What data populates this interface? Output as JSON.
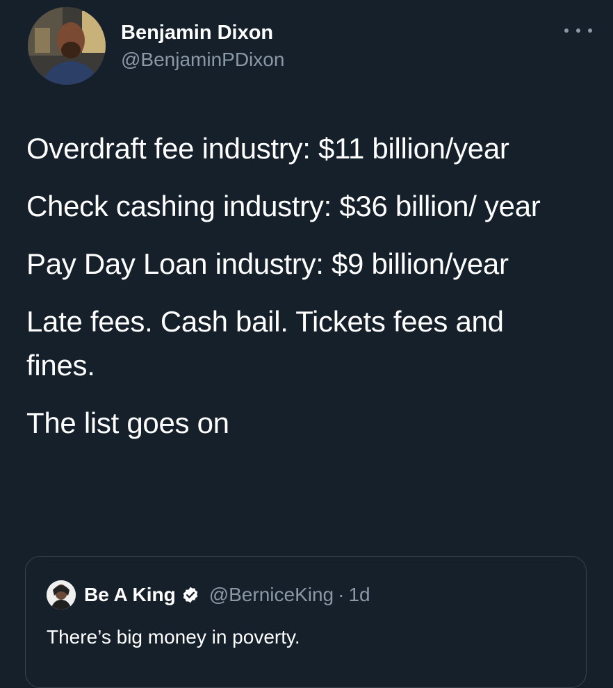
{
  "tweet": {
    "author": {
      "name": "Benjamin Dixon",
      "handle": "@BenjaminPDixon",
      "avatar_icon": "profile-photo"
    },
    "more_icon": "more-horizontal-icon",
    "lines": [
      "Overdraft fee industry: $11 billion/year",
      "Check cashing industry: $36 billion/ year",
      "Pay Day Loan industry: $9 billion/year",
      "Late fees. Cash bail. Tickets fees and fines.",
      "The list goes on"
    ]
  },
  "quoted_tweet": {
    "name": "Be A King",
    "verified_icon": "verified-badge-icon",
    "handle": "@BerniceKing",
    "separator": "·",
    "time": "1d",
    "text": "There’s big money in poverty."
  },
  "colors": {
    "background": "#15202b",
    "text_primary": "#ffffff",
    "text_secondary": "#8b98a5",
    "border": "#38444d"
  }
}
